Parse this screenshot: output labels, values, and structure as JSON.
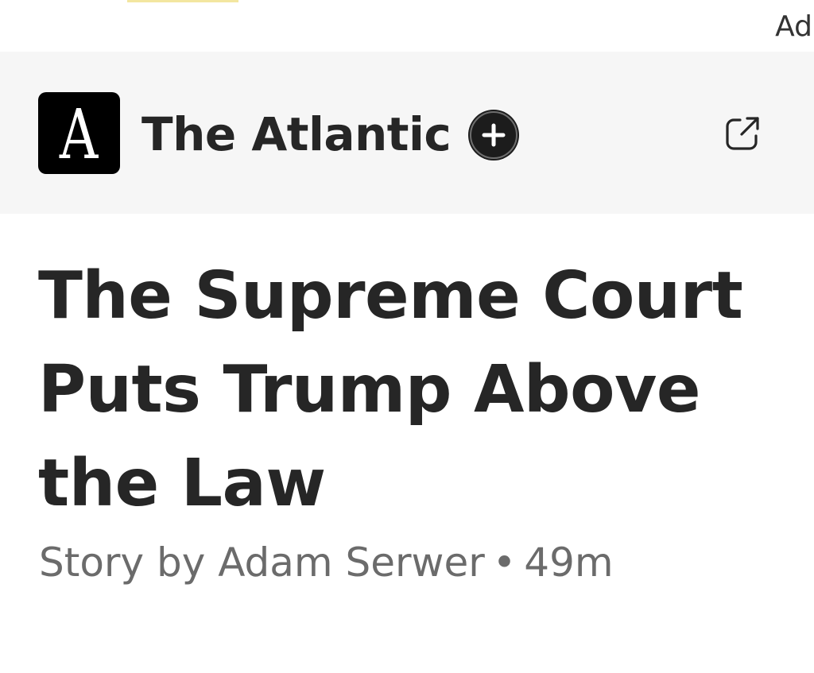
{
  "ad": {
    "label": "Ad"
  },
  "source": {
    "logo_letter": "A",
    "name": "The Atlantic",
    "follow_icon": "plus-circle-icon",
    "open_icon": "external-link-icon"
  },
  "article": {
    "headline": "The Supreme Court Puts Trump Above the Law",
    "byline_prefix": "Story by Adam Serwer",
    "byline_separator": "•",
    "age": "49m"
  },
  "colors": {
    "text": "#262626",
    "secondary_text": "#6b6b6b",
    "source_bar_bg": "#f6f6f6",
    "logo_bg": "#000000"
  }
}
